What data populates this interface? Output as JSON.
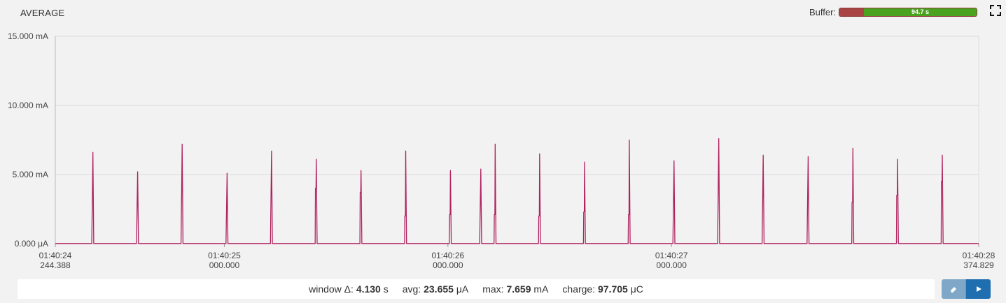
{
  "header": {
    "title": "AVERAGE",
    "buffer_label": "Buffer:",
    "buffer_value": "94.7 s",
    "buffer_fraction": 0.82
  },
  "footer": {
    "window_label": "window Δ:",
    "window_value": "4.130",
    "window_unit": "s",
    "avg_label": "avg:",
    "avg_value": "23.655",
    "avg_unit": "μA",
    "max_label": "max:",
    "max_value": "7.659",
    "max_unit": "mA",
    "charge_label": "charge:",
    "charge_value": "97.705",
    "charge_unit": "μC"
  },
  "colors": {
    "series": "#b0225f",
    "background": "#f2f2f2",
    "grid": "#d9d9d9",
    "buffer_used": "#a84444",
    "buffer_free": "#4aa31f",
    "button_primary": "#1f6fb0"
  },
  "icons": {
    "fullscreen": "fullscreen-icon",
    "reset": "eraser-icon",
    "play": "play-icon"
  },
  "chart_data": {
    "type": "line",
    "title": "AVERAGE",
    "y_unit": "mA",
    "ylim": [
      0,
      15
    ],
    "y_ticks": [
      {
        "value": 15,
        "label": "15.000 mA"
      },
      {
        "value": 10,
        "label": "10.000 mA"
      },
      {
        "value": 5,
        "label": "5.000 mA"
      },
      {
        "value": 0,
        "label": "0.000 μA"
      }
    ],
    "x_unit": "s",
    "xlim": [
      0,
      4.13
    ],
    "x_ticks": [
      {
        "value": 0,
        "line1": "01:40:24",
        "line2": "244.388"
      },
      {
        "value": 0.756,
        "line1": "01:40:25",
        "line2": "000.000"
      },
      {
        "value": 1.756,
        "line1": "01:40:26",
        "line2": "000.000"
      },
      {
        "value": 2.756,
        "line1": "01:40:27",
        "line2": "000.000"
      },
      {
        "value": 4.13,
        "line1": "01:40:28",
        "line2": "374.829"
      }
    ],
    "grid": true,
    "baseline_mA": 0.01,
    "series": [
      {
        "spikes": [
          {
            "t": 0.167,
            "peak": 6.6,
            "step": 0
          },
          {
            "t": 0.367,
            "peak": 5.2,
            "step": 0
          },
          {
            "t": 0.566,
            "peak": 7.2,
            "step": 0
          },
          {
            "t": 0.767,
            "peak": 5.1,
            "step": 0
          },
          {
            "t": 0.966,
            "peak": 6.7,
            "step": 0
          },
          {
            "t": 1.166,
            "peak": 6.1,
            "step": 4.0
          },
          {
            "t": 1.366,
            "peak": 5.3,
            "step": 3.7
          },
          {
            "t": 1.566,
            "peak": 6.7,
            "step": 2.0
          },
          {
            "t": 1.766,
            "peak": 5.3,
            "step": 2.1
          },
          {
            "t": 1.902,
            "peak": 5.4,
            "step": 0
          },
          {
            "t": 1.966,
            "peak": 7.2,
            "step": 2.1
          },
          {
            "t": 2.165,
            "peak": 6.5,
            "step": 2.0
          },
          {
            "t": 2.366,
            "peak": 5.9,
            "step": 2.3
          },
          {
            "t": 2.566,
            "peak": 7.5,
            "step": 2.1
          },
          {
            "t": 2.766,
            "peak": 6.0,
            "step": 0
          },
          {
            "t": 2.966,
            "peak": 7.6,
            "step": 0
          },
          {
            "t": 3.165,
            "peak": 6.4,
            "step": 0
          },
          {
            "t": 3.366,
            "peak": 6.3,
            "step": 0
          },
          {
            "t": 3.566,
            "peak": 6.9,
            "step": 3.0
          },
          {
            "t": 3.766,
            "peak": 6.1,
            "step": 3.5
          },
          {
            "t": 3.966,
            "peak": 6.4,
            "step": 4.5
          }
        ]
      }
    ]
  }
}
